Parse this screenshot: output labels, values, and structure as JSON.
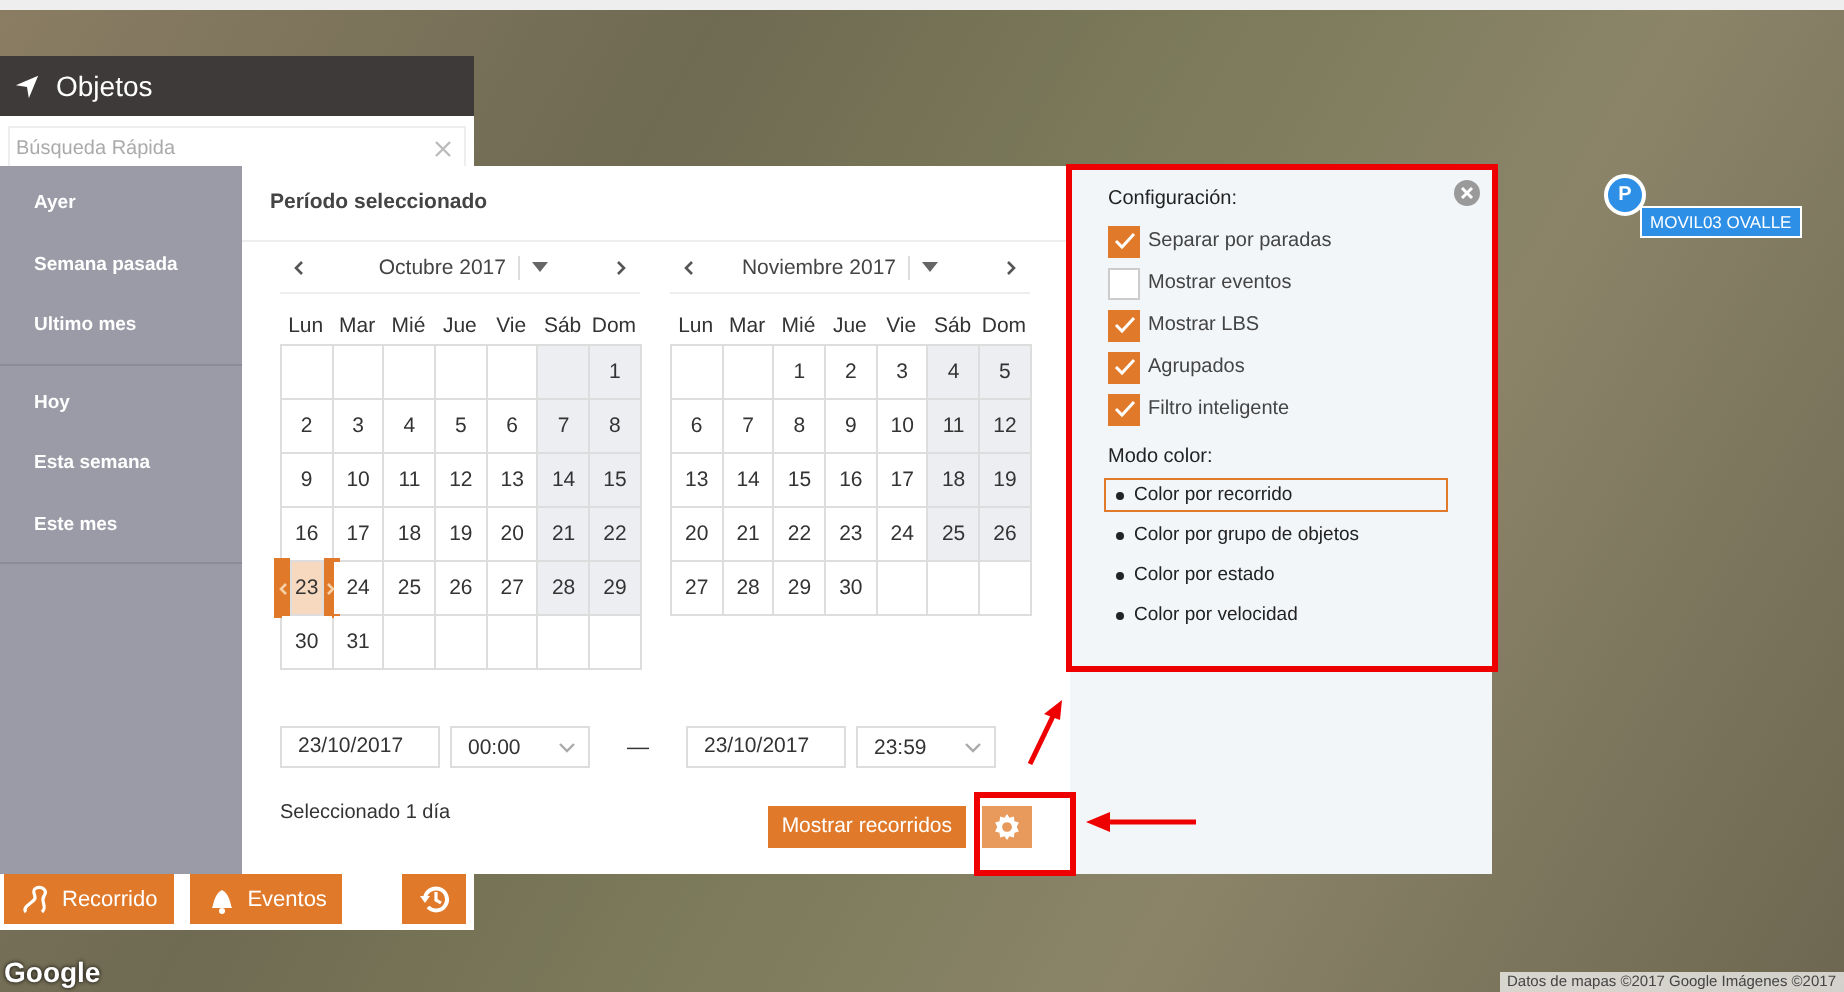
{
  "objects_panel": {
    "title": "Objetos",
    "search": {
      "placeholder": "Búsqueda Rápida"
    },
    "buttons": [
      {
        "kind": "route",
        "label": "Recorrido"
      },
      {
        "kind": "events",
        "label": "Eventos"
      },
      {
        "kind": "history"
      }
    ]
  },
  "presets": [
    [
      {
        "label": "Ayer"
      },
      {
        "label": "Semana pasada"
      },
      {
        "label": "Ultimo mes"
      }
    ],
    [
      {
        "label": "Hoy"
      },
      {
        "label": "Esta semana"
      },
      {
        "label": "Este mes"
      }
    ]
  ],
  "period": {
    "title": "Período seleccionado",
    "calendars": [
      {
        "month": "Octubre 2017",
        "weekdays": [
          "Lun",
          "Mar",
          "Mié",
          "Jue",
          "Vie",
          "Sáb",
          "Dom"
        ],
        "weeks": [
          [
            {
              "kind": "blank"
            },
            {
              "kind": "blank"
            },
            {
              "kind": "blank"
            },
            {
              "kind": "blank"
            },
            {
              "kind": "blank"
            },
            {
              "kind": "blank"
            },
            {
              "kind": "day",
              "day": "1",
              "selected": false
            }
          ],
          [
            {
              "kind": "day",
              "day": "2",
              "selected": false
            },
            {
              "kind": "day",
              "day": "3",
              "selected": false
            },
            {
              "kind": "day",
              "day": "4",
              "selected": false
            },
            {
              "kind": "day",
              "day": "5",
              "selected": false
            },
            {
              "kind": "day",
              "day": "6",
              "selected": false
            },
            {
              "kind": "day",
              "day": "7",
              "selected": false
            },
            {
              "kind": "day",
              "day": "8",
              "selected": false
            }
          ],
          [
            {
              "kind": "day",
              "day": "9",
              "selected": false
            },
            {
              "kind": "day",
              "day": "10",
              "selected": false
            },
            {
              "kind": "day",
              "day": "11",
              "selected": false
            },
            {
              "kind": "day",
              "day": "12",
              "selected": false
            },
            {
              "kind": "day",
              "day": "13",
              "selected": false
            },
            {
              "kind": "day",
              "day": "14",
              "selected": false
            },
            {
              "kind": "day",
              "day": "15",
              "selected": false
            }
          ],
          [
            {
              "kind": "day",
              "day": "16",
              "selected": false
            },
            {
              "kind": "day",
              "day": "17",
              "selected": false
            },
            {
              "kind": "day",
              "day": "18",
              "selected": false
            },
            {
              "kind": "day",
              "day": "19",
              "selected": false
            },
            {
              "kind": "day",
              "day": "20",
              "selected": false
            },
            {
              "kind": "day",
              "day": "21",
              "selected": false
            },
            {
              "kind": "day",
              "day": "22",
              "selected": false
            }
          ],
          [
            {
              "kind": "day",
              "day": "23",
              "selected": true
            },
            {
              "kind": "day",
              "day": "24",
              "selected": false
            },
            {
              "kind": "day",
              "day": "25",
              "selected": false
            },
            {
              "kind": "day",
              "day": "26",
              "selected": false
            },
            {
              "kind": "day",
              "day": "27",
              "selected": false
            },
            {
              "kind": "day",
              "day": "28",
              "selected": false
            },
            {
              "kind": "day",
              "day": "29",
              "selected": false
            }
          ],
          [
            {
              "kind": "day",
              "day": "30",
              "selected": false
            },
            {
              "kind": "day",
              "day": "31",
              "selected": false
            },
            {
              "kind": "blank"
            },
            {
              "kind": "blank"
            },
            {
              "kind": "blank"
            },
            {
              "kind": "blank"
            },
            {
              "kind": "blank"
            }
          ]
        ]
      },
      {
        "month": "Noviembre 2017",
        "weekdays": [
          "Lun",
          "Mar",
          "Mié",
          "Jue",
          "Vie",
          "Sáb",
          "Dom"
        ],
        "weeks": [
          [
            {
              "kind": "blank"
            },
            {
              "kind": "blank"
            },
            {
              "kind": "day",
              "day": "1",
              "selected": false
            },
            {
              "kind": "day",
              "day": "2",
              "selected": false
            },
            {
              "kind": "day",
              "day": "3",
              "selected": false
            },
            {
              "kind": "day",
              "day": "4",
              "selected": false
            },
            {
              "kind": "day",
              "day": "5",
              "selected": false
            }
          ],
          [
            {
              "kind": "day",
              "day": "6",
              "selected": false
            },
            {
              "kind": "day",
              "day": "7",
              "selected": false
            },
            {
              "kind": "day",
              "day": "8",
              "selected": false
            },
            {
              "kind": "day",
              "day": "9",
              "selected": false
            },
            {
              "kind": "day",
              "day": "10",
              "selected": false
            },
            {
              "kind": "day",
              "day": "11",
              "selected": false
            },
            {
              "kind": "day",
              "day": "12",
              "selected": false
            }
          ],
          [
            {
              "kind": "day",
              "day": "13",
              "selected": false
            },
            {
              "kind": "day",
              "day": "14",
              "selected": false
            },
            {
              "kind": "day",
              "day": "15",
              "selected": false
            },
            {
              "kind": "day",
              "day": "16",
              "selected": false
            },
            {
              "kind": "day",
              "day": "17",
              "selected": false
            },
            {
              "kind": "day",
              "day": "18",
              "selected": false
            },
            {
              "kind": "day",
              "day": "19",
              "selected": false
            }
          ],
          [
            {
              "kind": "day",
              "day": "20",
              "selected": false
            },
            {
              "kind": "day",
              "day": "21",
              "selected": false
            },
            {
              "kind": "day",
              "day": "22",
              "selected": false
            },
            {
              "kind": "day",
              "day": "23",
              "selected": false
            },
            {
              "kind": "day",
              "day": "24",
              "selected": false
            },
            {
              "kind": "day",
              "day": "25",
              "selected": false
            },
            {
              "kind": "day",
              "day": "26",
              "selected": false
            }
          ],
          [
            {
              "kind": "day",
              "day": "27",
              "selected": false
            },
            {
              "kind": "day",
              "day": "28",
              "selected": false
            },
            {
              "kind": "day",
              "day": "29",
              "selected": false
            },
            {
              "kind": "day",
              "day": "30",
              "selected": false
            },
            {
              "kind": "blank"
            },
            {
              "kind": "blank"
            },
            {
              "kind": "blank"
            }
          ]
        ]
      }
    ],
    "from": {
      "date": "23/10/2017",
      "time": "00:00"
    },
    "separator": "—",
    "to": {
      "date": "23/10/2017",
      "time": "23:59"
    },
    "summary": "Seleccionado 1 día",
    "show_button": "Mostrar recorridos"
  },
  "settings": {
    "title": "Configuración:",
    "options": [
      {
        "label": "Separar por paradas",
        "checked": true
      },
      {
        "label": "Mostrar eventos",
        "checked": false
      },
      {
        "label": "Mostrar LBS",
        "checked": true
      },
      {
        "label": "Agrupados",
        "checked": true
      },
      {
        "label": "Filtro inteligente",
        "checked": true
      }
    ],
    "color_mode_title": "Modo color:",
    "color_modes": [
      {
        "label": "Color por recorrido",
        "selected": true
      },
      {
        "label": "Color por grupo de objetos",
        "selected": false
      },
      {
        "label": "Color por estado",
        "selected": false
      },
      {
        "label": "Color por velocidad",
        "selected": false
      }
    ]
  },
  "map": {
    "marker": {
      "letter": "P",
      "label": "MOVIL03 OVALLE"
    },
    "logo": "Google",
    "attribution": "Datos de mapas ©2017 Google Imágenes ©2017"
  }
}
